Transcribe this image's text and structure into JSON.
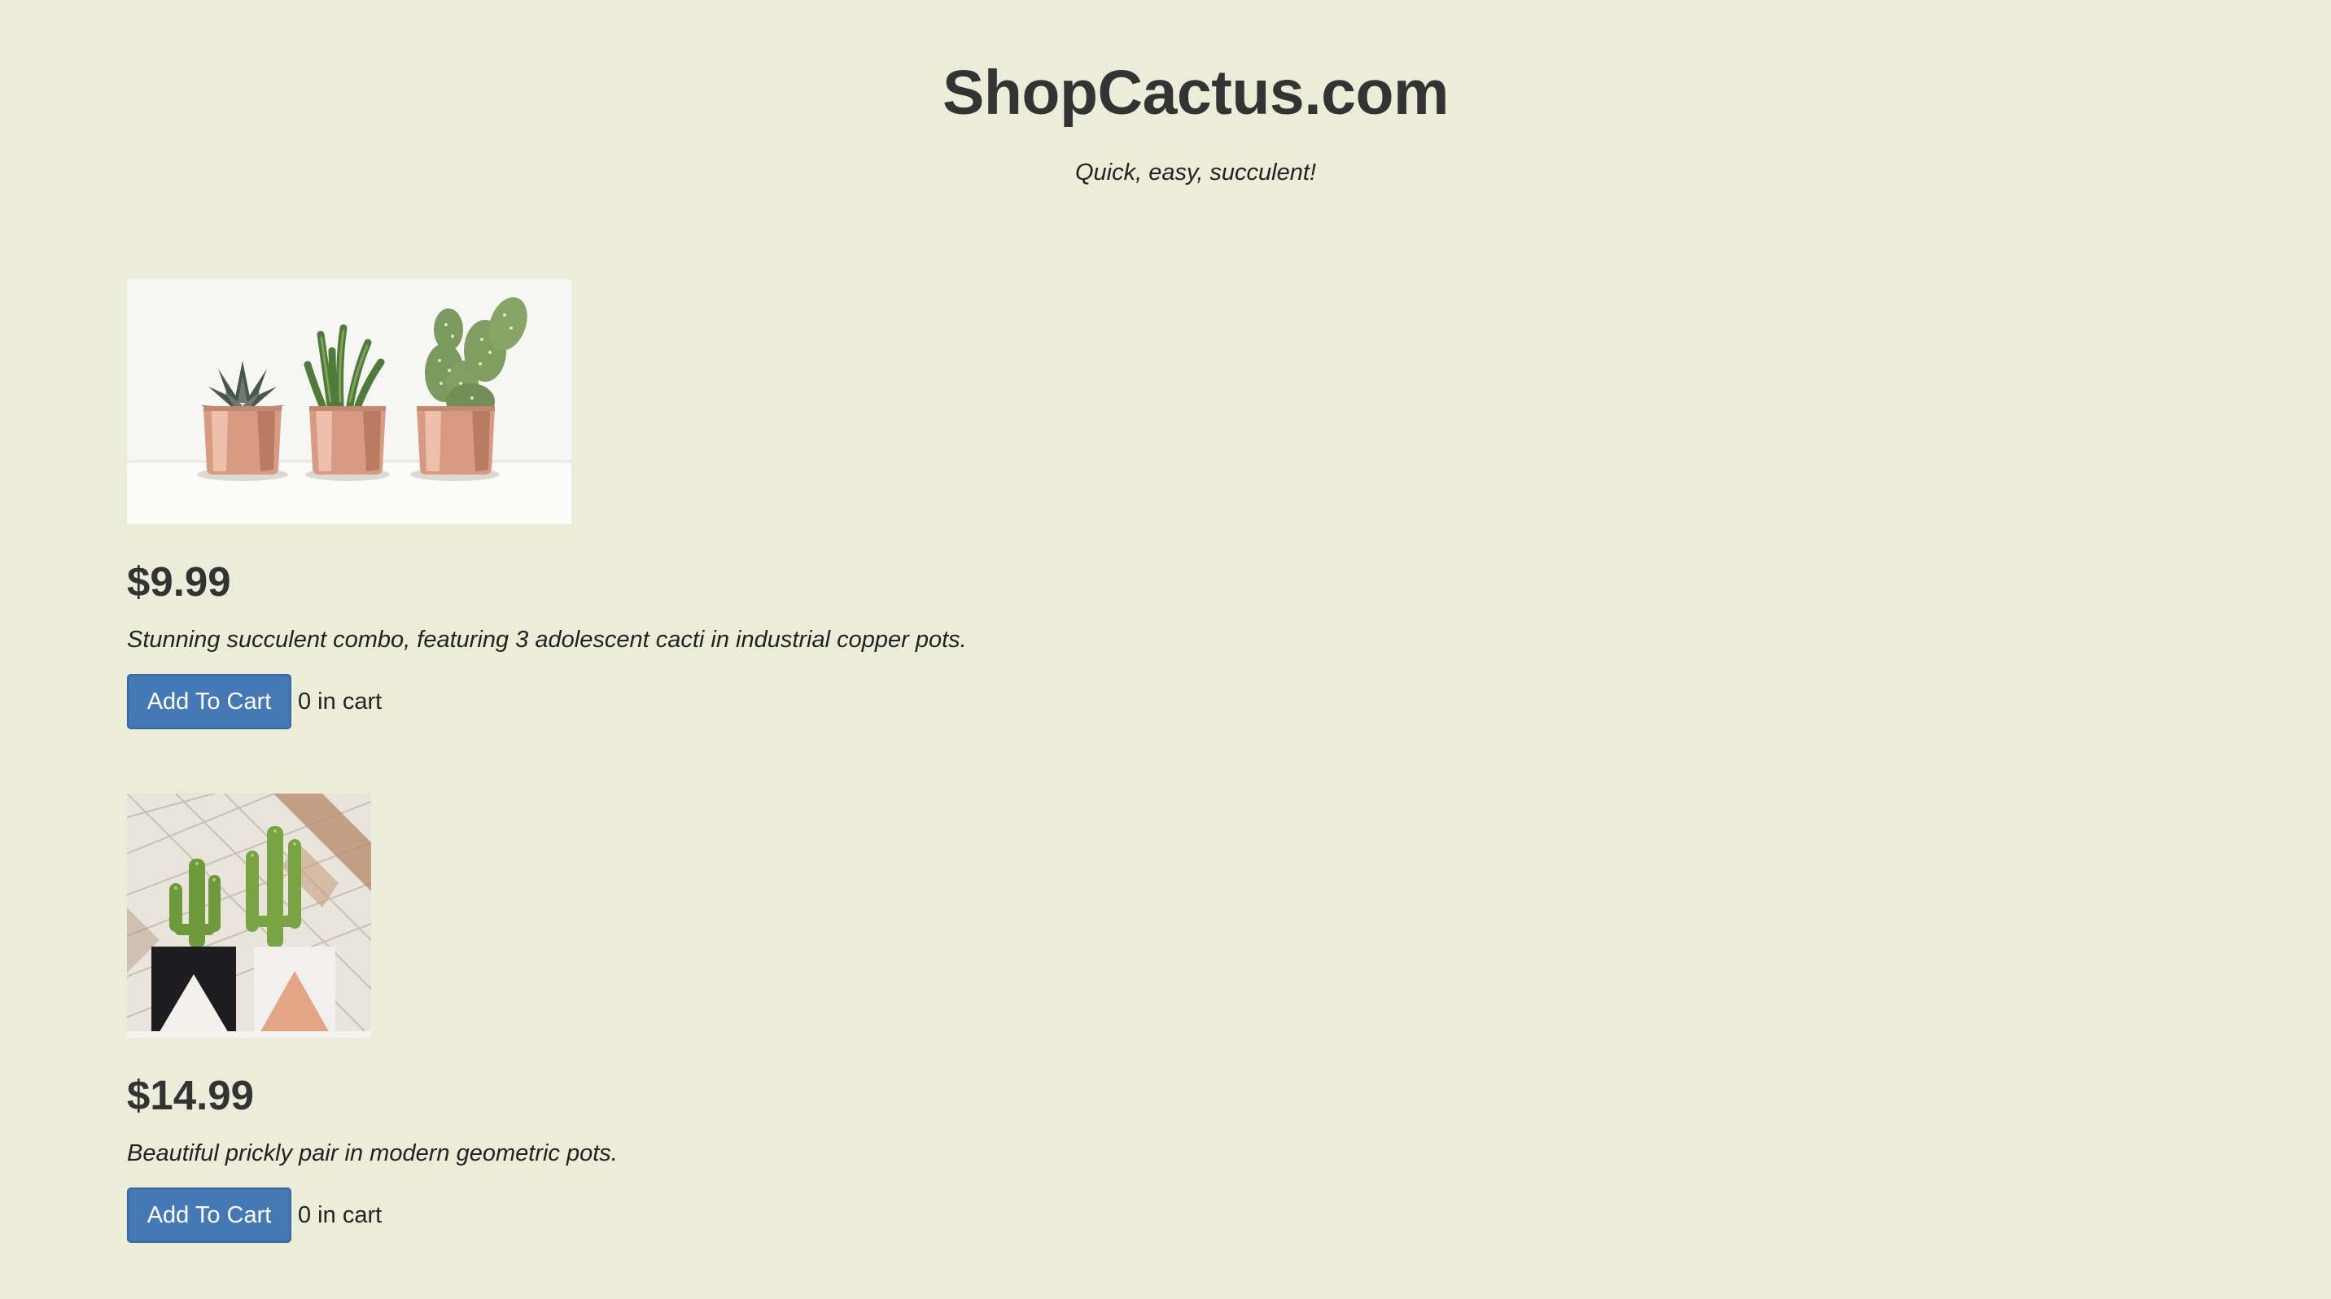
{
  "header": {
    "title": "ShopCactus.com",
    "tagline": "Quick, easy, succulent!"
  },
  "products": [
    {
      "price": "$9.99",
      "description": "Stunning succulent combo, featuring 3 adolescent cacti in industrial copper pots.",
      "button_label": "Add To Cart",
      "cart_count": "0 in cart"
    },
    {
      "price": "$14.99",
      "description": "Beautiful prickly pair in modern geometric pots.",
      "button_label": "Add To Cart",
      "cart_count": "0 in cart"
    }
  ],
  "colors": {
    "background": "#ecedd8",
    "button": "#4479b5",
    "text": "#333333"
  }
}
